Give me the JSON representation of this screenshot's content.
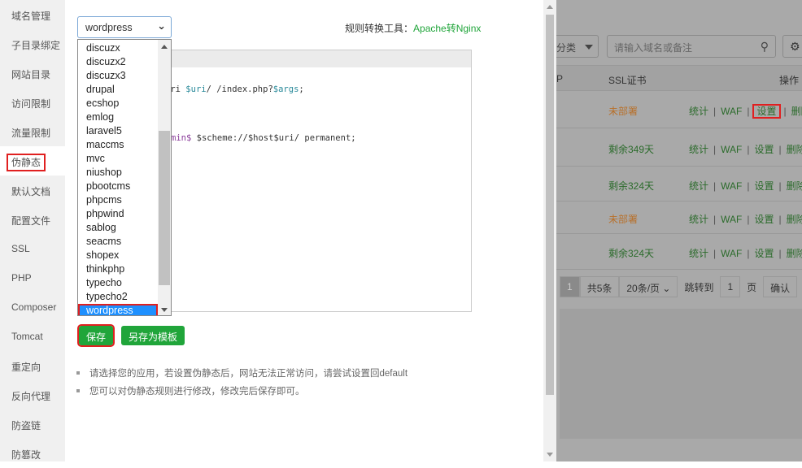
{
  "sidebar": {
    "items": [
      "域名管理",
      "子目录绑定",
      "网站目录",
      "访问限制",
      "流量限制",
      "伪静态",
      "默认文档",
      "配置文件",
      "SSL",
      "PHP",
      "Composer",
      "Tomcat",
      "重定向",
      "反向代理",
      "防盗链",
      "防篡改"
    ],
    "active": "伪静态"
  },
  "rewrite": {
    "selected": "wordpress",
    "options": [
      "discuzx",
      "discuzx2",
      "discuzx3",
      "drupal",
      "ecshop",
      "emlog",
      "laravel5",
      "maccms",
      "mvc",
      "niushop",
      "pbootcms",
      "phpcms",
      "phpwind",
      "sablog",
      "seacms",
      "shopex",
      "thinkphp",
      "typecho",
      "typecho2",
      "wordpress"
    ],
    "tool_label": "规则转换工具：",
    "tool_link": "Apache转Nginx",
    "code_line1_a": "uri ",
    "code_line1_b": "$uri",
    "code_line1_c": "/ /index.php?",
    "code_line1_d": "$args",
    "code_line1_e": ";",
    "code_line2_a": "min$",
    "code_line2_b": " $scheme://$host$uri/ permanent;",
    "save": "保存",
    "save_template": "另存为模板",
    "notes": [
      "请选择您的应用，若设置伪静态后，网站无法正常访问，请尝试设置回default",
      "您可以对伪静态规则进行修改，修改完后保存即可。"
    ]
  },
  "background": {
    "filter_label": "分类",
    "search_placeholder": "请输入域名或备注",
    "headers": {
      "col_p": "P",
      "ssl": "SSL证书",
      "ops": "操作"
    },
    "rows": [
      {
        "ssl": "未部署",
        "status": "none"
      },
      {
        "ssl": "剩余349天",
        "status": "ok"
      },
      {
        "ssl": "剩余324天",
        "status": "ok"
      },
      {
        "ssl": "未部署",
        "status": "none"
      },
      {
        "ssl": "剩余324天",
        "status": "ok"
      }
    ],
    "actions": [
      "统计",
      "WAF",
      "设置",
      "删除"
    ],
    "pager": {
      "current": "1",
      "total": "共5条",
      "per_page": "20条/页",
      "jump": "跳转到",
      "page_input": "1",
      "page_unit": "页",
      "confirm": "确认"
    },
    "colors": {
      "green": "#20a53a",
      "orange": "#b8702a",
      "highlight": "#e02020"
    }
  }
}
